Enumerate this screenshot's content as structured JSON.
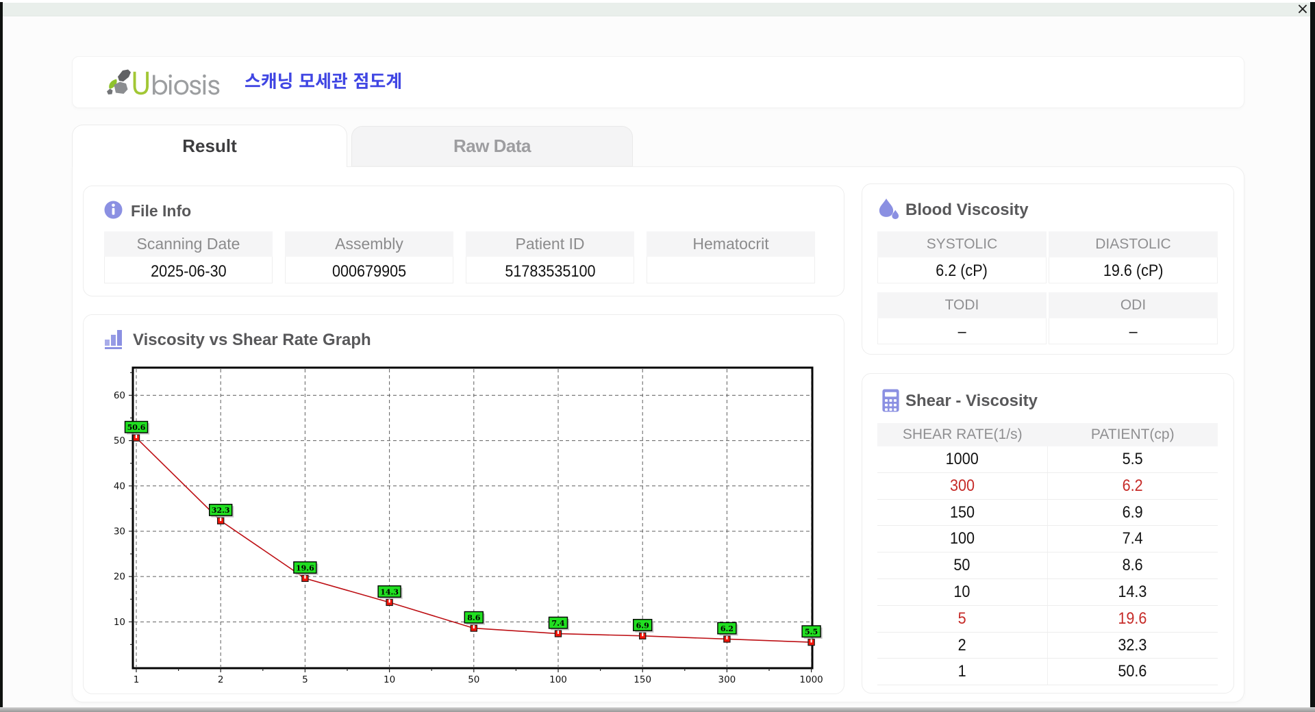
{
  "window": {
    "close_label": "×"
  },
  "header": {
    "logo": {
      "first_letter": "U",
      "rest": "biosis"
    },
    "app_title_korean": "스캐닝 모세관 점도계"
  },
  "tabs": {
    "result": "Result",
    "raw_data": "Raw Data"
  },
  "file_info": {
    "title": "File Info",
    "fields": [
      {
        "label": "Scanning Date",
        "value": "2025-06-30"
      },
      {
        "label": "Assembly",
        "value": "000679905"
      },
      {
        "label": "Patient ID",
        "value": "51783535100"
      },
      {
        "label": "Hematocrit",
        "value": ""
      }
    ]
  },
  "blood_viscosity": {
    "title": "Blood Viscosity",
    "groups": [
      {
        "cells": [
          {
            "label": "SYSTOLIC",
            "value": "6.2 (cP)"
          },
          {
            "label": "DIASTOLIC",
            "value": "19.6 (cP)"
          }
        ]
      },
      {
        "cells": [
          {
            "label": "TODI",
            "value": "–"
          },
          {
            "label": "ODI",
            "value": "–"
          }
        ]
      }
    ]
  },
  "shear_viscosity": {
    "title": "Shear - Viscosity",
    "columns": [
      "SHEAR RATE(1/s)",
      "PATIENT(cp)"
    ],
    "rows": [
      {
        "shear_rate": "1000",
        "patient": "5.5",
        "highlight": false
      },
      {
        "shear_rate": "300",
        "patient": "6.2",
        "highlight": true
      },
      {
        "shear_rate": "150",
        "patient": "6.9",
        "highlight": false
      },
      {
        "shear_rate": "100",
        "patient": "7.4",
        "highlight": false
      },
      {
        "shear_rate": "50",
        "patient": "8.6",
        "highlight": false
      },
      {
        "shear_rate": "10",
        "patient": "14.3",
        "highlight": false
      },
      {
        "shear_rate": "5",
        "patient": "19.6",
        "highlight": true
      },
      {
        "shear_rate": "2",
        "patient": "32.3",
        "highlight": false
      },
      {
        "shear_rate": "1",
        "patient": "50.6",
        "highlight": false
      }
    ]
  },
  "chart_data": {
    "type": "line",
    "title": "Viscosity vs Shear Rate Graph",
    "xlabel": "",
    "ylabel": "",
    "x_categories": [
      "1",
      "2",
      "5",
      "10",
      "50",
      "100",
      "150",
      "300",
      "1000"
    ],
    "series": [
      {
        "name": "PATIENT(cp)",
        "values": [
          50.6,
          32.3,
          19.6,
          14.3,
          8.6,
          7.4,
          6.9,
          6.2,
          5.5
        ]
      }
    ],
    "point_labels": [
      "50.6",
      "32.3",
      "19.6",
      "14.3",
      "8.6",
      "7.4",
      "6.9",
      "6.2",
      "5.5"
    ],
    "y_ticks": [
      10,
      20,
      30,
      40,
      50,
      60
    ],
    "ylim": [
      0,
      65.8
    ],
    "grid": "dashed",
    "legend": "none",
    "x_scale_note": "category ticks evenly spaced",
    "line_color": "#bd0f14",
    "marker_color": "#f01408",
    "marker_border": "#1a1a1a",
    "label_fill": "#21df21",
    "label_border": "#000000",
    "grid_color": "#5e5e5e",
    "frame_color": "#050505"
  },
  "colors": {
    "accent_icon": "#8b90e2",
    "korean_title": "#4046e3",
    "logo_green": "#a2c735",
    "logo_gray": "#9c9ea0",
    "titlebar": "#e9efeb",
    "band_gray": "#f5f5f6",
    "value_red": "#c62b28"
  }
}
